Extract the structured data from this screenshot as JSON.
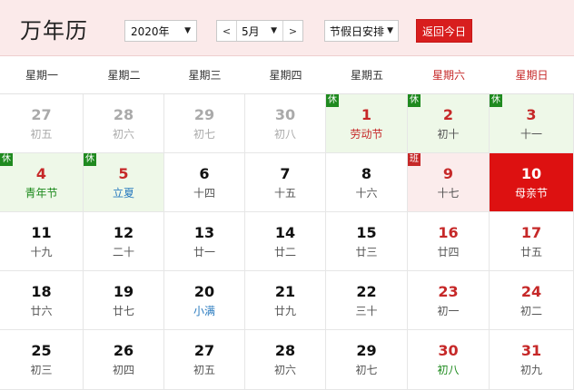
{
  "header": {
    "title": "万年历",
    "year_value": "2020年",
    "month_value": "5月",
    "holiday_select_value": "节假日安排",
    "today_button": "返回今日",
    "prev_arrow": "<",
    "next_arrow": ">",
    "caret": "▼"
  },
  "weekdays": [
    {
      "label": "星期一",
      "weekend": false
    },
    {
      "label": "星期二",
      "weekend": false
    },
    {
      "label": "星期三",
      "weekend": false
    },
    {
      "label": "星期四",
      "weekend": false
    },
    {
      "label": "星期五",
      "weekend": false
    },
    {
      "label": "星期六",
      "weekend": true
    },
    {
      "label": "星期日",
      "weekend": true
    }
  ],
  "days": [
    {
      "day": "27",
      "lunar": "初五",
      "other": true
    },
    {
      "day": "28",
      "lunar": "初六",
      "other": true
    },
    {
      "day": "29",
      "lunar": "初七",
      "other": true
    },
    {
      "day": "30",
      "lunar": "初八",
      "other": true
    },
    {
      "day": "1",
      "lunar": "劳动节",
      "badge": "休",
      "state": "rest",
      "weekend": true,
      "lunar_style": "festival-red"
    },
    {
      "day": "2",
      "lunar": "初十",
      "badge": "休",
      "state": "rest",
      "weekend": true
    },
    {
      "day": "3",
      "lunar": "十一",
      "badge": "休",
      "state": "rest",
      "weekend": true
    },
    {
      "day": "4",
      "lunar": "青年节",
      "badge": "休",
      "state": "rest",
      "weekend": true,
      "lunar_style": "festival-green"
    },
    {
      "day": "5",
      "lunar": "立夏",
      "badge": "休",
      "state": "rest",
      "weekend": true,
      "lunar_style": "term-blue"
    },
    {
      "day": "6",
      "lunar": "十四"
    },
    {
      "day": "7",
      "lunar": "十五"
    },
    {
      "day": "8",
      "lunar": "十六"
    },
    {
      "day": "9",
      "lunar": "十七",
      "badge": "班",
      "state": "work",
      "weekend": true
    },
    {
      "day": "10",
      "lunar": "母亲节",
      "state": "today"
    },
    {
      "day": "11",
      "lunar": "十九"
    },
    {
      "day": "12",
      "lunar": "二十"
    },
    {
      "day": "13",
      "lunar": "廿一"
    },
    {
      "day": "14",
      "lunar": "廿二"
    },
    {
      "day": "15",
      "lunar": "廿三"
    },
    {
      "day": "16",
      "lunar": "廿四",
      "weekend": true
    },
    {
      "day": "17",
      "lunar": "廿五",
      "weekend": true
    },
    {
      "day": "18",
      "lunar": "廿六"
    },
    {
      "day": "19",
      "lunar": "廿七"
    },
    {
      "day": "20",
      "lunar": "小满",
      "lunar_style": "term-blue"
    },
    {
      "day": "21",
      "lunar": "廿九"
    },
    {
      "day": "22",
      "lunar": "三十"
    },
    {
      "day": "23",
      "lunar": "初一",
      "weekend": true
    },
    {
      "day": "24",
      "lunar": "初二",
      "weekend": true
    },
    {
      "day": "25",
      "lunar": "初三"
    },
    {
      "day": "26",
      "lunar": "初四"
    },
    {
      "day": "27",
      "lunar": "初五"
    },
    {
      "day": "28",
      "lunar": "初六"
    },
    {
      "day": "29",
      "lunar": "初七"
    },
    {
      "day": "30",
      "lunar": "初八",
      "weekend": true,
      "lunar_style": "festival-green"
    },
    {
      "day": "31",
      "lunar": "初九",
      "weekend": true
    }
  ],
  "colors": {
    "accent_red": "#d81e1e",
    "rest_green": "#1f8a1f",
    "rest_bg": "#eef8e8",
    "work_bg": "#fbecec",
    "header_bg": "#fbeaea"
  }
}
